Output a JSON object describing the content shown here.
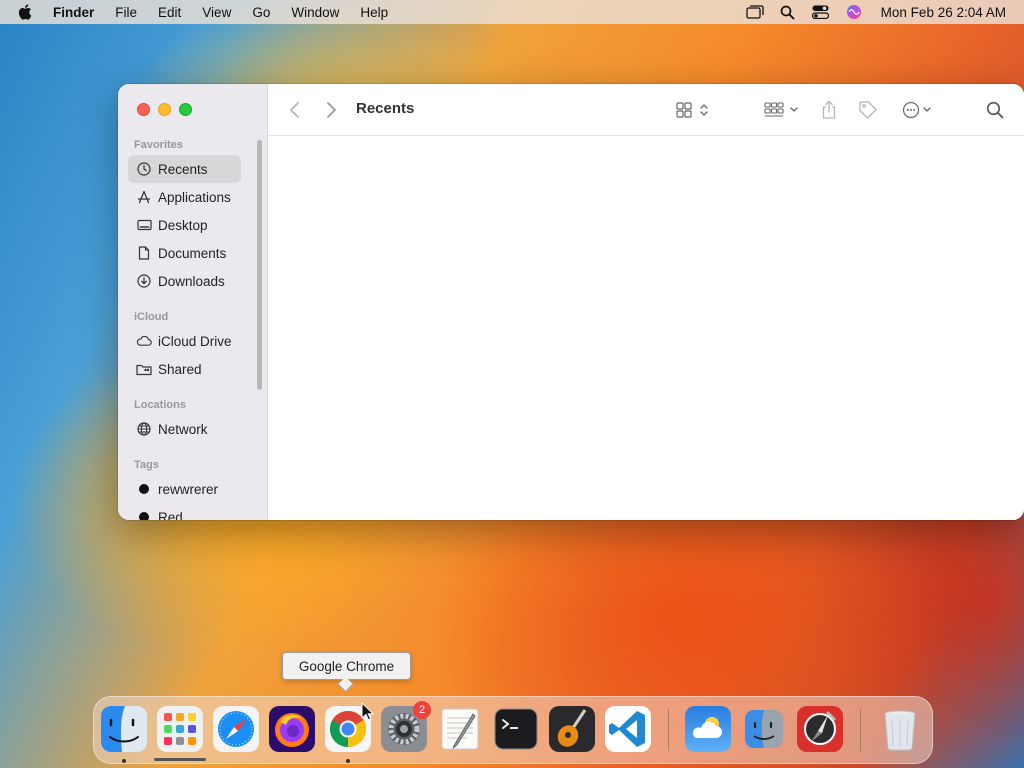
{
  "menubar": {
    "app_name": "Finder",
    "items": [
      "File",
      "Edit",
      "View",
      "Go",
      "Window",
      "Help"
    ],
    "clock": "Mon Feb 26  2:04 AM",
    "status_icons": [
      "screen-mirror-icon",
      "spotlight-search-icon",
      "control-center-icon",
      "siri-icon"
    ]
  },
  "finder": {
    "title": "Recents",
    "sidebar": {
      "favorites_header": "Favorites",
      "favorites": [
        {
          "label": "Recents",
          "icon": "clock-icon",
          "active": true
        },
        {
          "label": "Applications",
          "icon": "applications-icon"
        },
        {
          "label": "Desktop",
          "icon": "desktop-icon"
        },
        {
          "label": "Documents",
          "icon": "document-icon"
        },
        {
          "label": "Downloads",
          "icon": "download-icon"
        }
      ],
      "icloud_header": "iCloud",
      "icloud": [
        {
          "label": "iCloud Drive",
          "icon": "cloud-icon"
        },
        {
          "label": "Shared",
          "icon": "shared-folder-icon"
        }
      ],
      "locations_header": "Locations",
      "locations": [
        {
          "label": "Network",
          "icon": "globe-icon"
        }
      ],
      "tags_header": "Tags",
      "tags": [
        {
          "label": "rewwrerer",
          "color": "#111111"
        },
        {
          "label": "Red",
          "color": "#111111"
        }
      ]
    },
    "toolbar_icons": [
      "back-icon",
      "forward-icon",
      "grid-view-icon",
      "group-icon",
      "share-icon",
      "tag-icon",
      "more-actions-icon",
      "search-icon"
    ]
  },
  "dock": {
    "tooltip": "Google Chrome",
    "apps": [
      {
        "name": "Finder",
        "running": true
      },
      {
        "name": "Launchpad"
      },
      {
        "name": "Safari"
      },
      {
        "name": "Firefox"
      },
      {
        "name": "Google Chrome",
        "running": true
      },
      {
        "name": "System Settings",
        "badge": "2"
      },
      {
        "name": "TextEdit"
      },
      {
        "name": "Terminal"
      },
      {
        "name": "GarageBand"
      },
      {
        "name": "Visual Studio Code"
      },
      {
        "name": "Weather"
      },
      {
        "name": "Migration Assistant"
      },
      {
        "name": "Directory Utility"
      },
      {
        "name": "Trash"
      }
    ]
  }
}
